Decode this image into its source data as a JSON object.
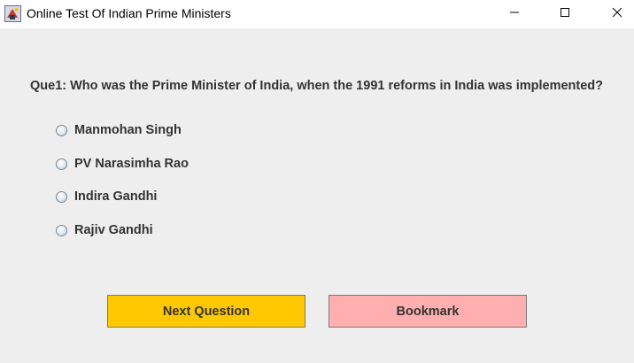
{
  "window": {
    "title": "Online Test Of Indian Prime Ministers"
  },
  "icons": {
    "app": "java-app-icon",
    "minimize": "minimize-icon",
    "maximize": "maximize-icon",
    "close": "close-icon"
  },
  "question": {
    "text": "Que1: Who was the Prime Minister of India, when the 1991 reforms in India was implemented?"
  },
  "options": [
    {
      "label": "Manmohan Singh",
      "selected": false
    },
    {
      "label": "PV Narasimha Rao",
      "selected": false
    },
    {
      "label": "Indira Gandhi",
      "selected": false
    },
    {
      "label": "Rajiv Gandhi",
      "selected": false
    }
  ],
  "buttons": {
    "next_label": "Next Question",
    "next_color": "#ffc800",
    "bookmark_label": "Bookmark",
    "bookmark_color": "#ffafaf"
  }
}
